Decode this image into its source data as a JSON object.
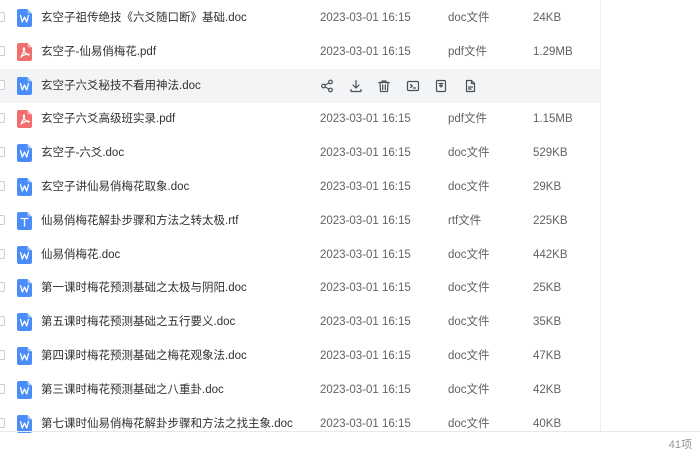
{
  "files": [
    {
      "name": "玄空子祖传绝技《六爻随口断》基础.doc",
      "date": "2023-03-01 16:15",
      "type": "doc文件",
      "size": "24KB",
      "icon": "word-file-icon"
    },
    {
      "name": "玄空子-仙易俏梅花.pdf",
      "date": "2023-03-01 16:15",
      "type": "pdf文件",
      "size": "1.29MB",
      "icon": "pdf-file-icon"
    },
    {
      "name": "玄空子六爻秘技不看用神法.doc",
      "date": "",
      "type": "",
      "size": "",
      "icon": "word-file-icon",
      "hover": true
    },
    {
      "name": "玄空子六爻高级班实录.pdf",
      "date": "2023-03-01 16:15",
      "type": "pdf文件",
      "size": "1.15MB",
      "icon": "pdf-file-icon"
    },
    {
      "name": "玄空子-六爻.doc",
      "date": "2023-03-01 16:15",
      "type": "doc文件",
      "size": "529KB",
      "icon": "word-file-icon"
    },
    {
      "name": "玄空子讲仙易俏梅花取象.doc",
      "date": "2023-03-01 16:15",
      "type": "doc文件",
      "size": "29KB",
      "icon": "word-file-icon"
    },
    {
      "name": "仙易俏梅花解卦步骤和方法之转太极.rtf",
      "date": "2023-03-01 16:15",
      "type": "rtf文件",
      "size": "225KB",
      "icon": "text-file-icon"
    },
    {
      "name": "仙易俏梅花.doc",
      "date": "2023-03-01 16:15",
      "type": "doc文件",
      "size": "442KB",
      "icon": "word-file-icon"
    },
    {
      "name": "第一课时梅花预测基础之太极与阴阳.doc",
      "date": "2023-03-01 16:15",
      "type": "doc文件",
      "size": "25KB",
      "icon": "word-file-icon"
    },
    {
      "name": "第五课时梅花预测基础之五行要义.doc",
      "date": "2023-03-01 16:15",
      "type": "doc文件",
      "size": "35KB",
      "icon": "word-file-icon"
    },
    {
      "name": "第四课时梅花预测基础之梅花观象法.doc",
      "date": "2023-03-01 16:15",
      "type": "doc文件",
      "size": "47KB",
      "icon": "word-file-icon"
    },
    {
      "name": "第三课时梅花预测基础之八重卦.doc",
      "date": "2023-03-01 16:15",
      "type": "doc文件",
      "size": "42KB",
      "icon": "word-file-icon"
    },
    {
      "name": "第七课时仙易俏梅花解卦步骤和方法之找主象.doc",
      "date": "2023-03-01 16:15",
      "type": "doc文件",
      "size": "40KB",
      "icon": "word-file-icon"
    }
  ],
  "hover_actions": [
    "share-icon",
    "download-icon",
    "delete-icon",
    "rename-icon",
    "move-icon",
    "copy-icon"
  ],
  "footer": {
    "count": "41项"
  },
  "colors": {
    "word": "#4a8df8",
    "pdf": "#f26d6d",
    "text": "#4a8df8",
    "hover_bg": "#f3f4f6"
  }
}
